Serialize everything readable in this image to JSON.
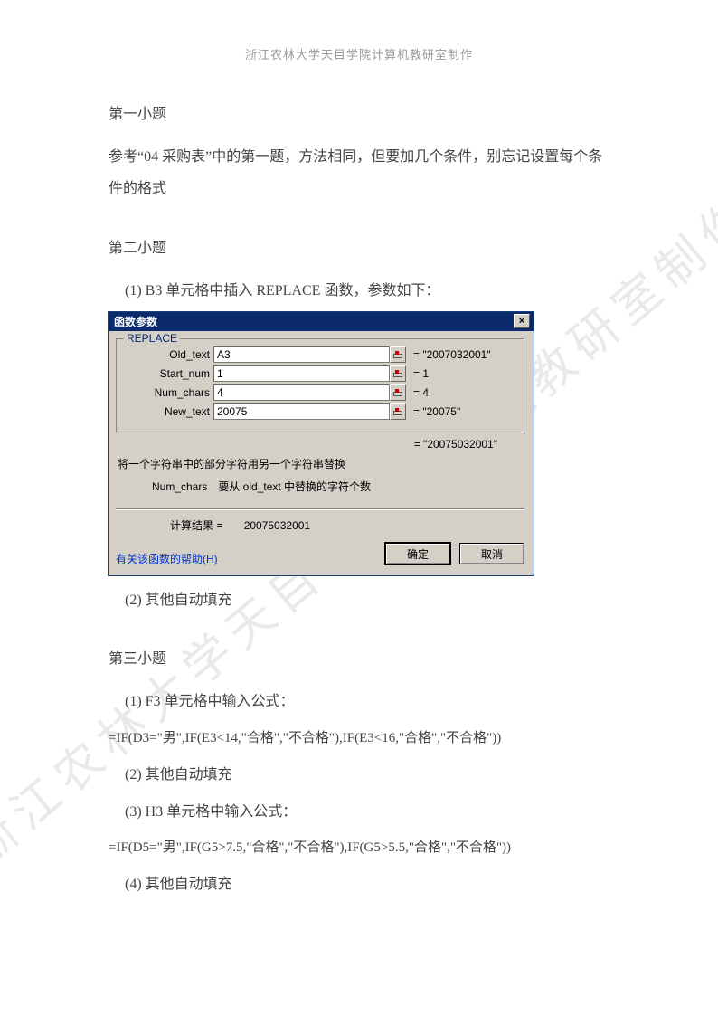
{
  "header": "浙江农林大学天目学院计算机教研室制作",
  "watermark": "浙江农林大学天目学院计算机教研室制作",
  "q1": {
    "title": "第一小题",
    "text": "参考“04 采购表”中的第一题，方法相同，但要加几个条件，别忘记设置每个条件的格式"
  },
  "q2": {
    "title": "第二小题",
    "step1": "(1)  B3 单元格中插入 REPLACE 函数，参数如下：",
    "step2": "(2)  其他自动填充"
  },
  "dialog": {
    "title": "函数参数",
    "group": "REPLACE",
    "rows": [
      {
        "label": "Old_text",
        "value": "A3",
        "result": "= \"2007032001\""
      },
      {
        "label": "Start_num",
        "value": "1",
        "result": "= 1"
      },
      {
        "label": "Num_chars",
        "value": "4",
        "result": "= 4"
      },
      {
        "label": "New_text",
        "value": "20075",
        "result": "= \"20075\""
      }
    ],
    "overall": "= \"20075032001\"",
    "desc": "将一个字符串中的部分字符用另一个字符串替换",
    "param_name": "Num_chars",
    "param_desc": "要从 old_text 中替换的字符个数",
    "calc_label": "计算结果 =",
    "calc_value": "20075032001",
    "help": "有关该函数的帮助(H)",
    "ok": "确定",
    "cancel": "取消"
  },
  "q3": {
    "title": "第三小题",
    "step1": "(1)  F3 单元格中输入公式：",
    "formula1": "=IF(D3=\"男\",IF(E3<14,\"合格\",\"不合格\"),IF(E3<16,\"合格\",\"不合格\"))",
    "step2": "(2)  其他自动填充",
    "step3": "(3)  H3 单元格中输入公式：",
    "formula2": "=IF(D5=\"男\",IF(G5>7.5,\"合格\",\"不合格\"),IF(G5>5.5,\"合格\",\"不合格\"))",
    "step4": "(4)  其他自动填充"
  }
}
